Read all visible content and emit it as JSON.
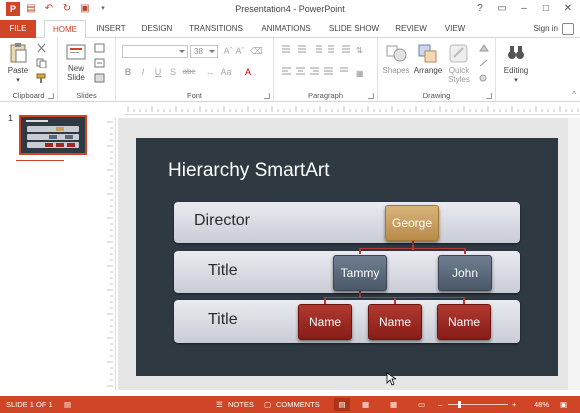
{
  "window": {
    "title": "Presentation4 - PowerPoint"
  },
  "tabs": {
    "file": "FILE",
    "home": "HOME",
    "insert": "INSERT",
    "design": "DESIGN",
    "transitions": "TRANSITIONS",
    "animations": "ANIMATIONS",
    "slideshow": "SLIDE SHOW",
    "review": "REVIEW",
    "view": "VIEW"
  },
  "signin": "Sign in",
  "ribbon": {
    "clipboard": {
      "label": "Clipboard",
      "paste": "Paste"
    },
    "slides": {
      "label": "Slides",
      "new_slide_1": "New",
      "new_slide_2": "Slide"
    },
    "font": {
      "label": "Font",
      "font_name": "",
      "font_size": "38",
      "bold": "B",
      "italic": "I",
      "underline": "U",
      "shadow": "S",
      "strike": "abc"
    },
    "paragraph": {
      "label": "Paragraph"
    },
    "drawing": {
      "label": "Drawing",
      "shapes": "Shapes",
      "arrange": "Arrange",
      "quick_1": "Quick",
      "quick_2": "Styles"
    },
    "editing": {
      "label": "Editing"
    }
  },
  "thumbnails": {
    "slide_number": "1"
  },
  "slide": {
    "title": "Hierarchy SmartArt",
    "bands": [
      {
        "label": "Director"
      },
      {
        "label": "Title"
      },
      {
        "label": "Title"
      }
    ],
    "nodes": {
      "george": "George",
      "tammy": "Tammy",
      "john": "John",
      "name1": "Name",
      "name2": "Name",
      "name3": "Name"
    },
    "colors": {
      "background": "#2f3942",
      "gold": "#c9a060",
      "slate": "#5a6878",
      "red": "#9c2a22"
    }
  },
  "statusbar": {
    "slide_info": "SLIDE 1 OF 1",
    "notes": "NOTES",
    "comments": "COMMENTS",
    "zoom": "48%"
  },
  "accent_color": "#d04525"
}
